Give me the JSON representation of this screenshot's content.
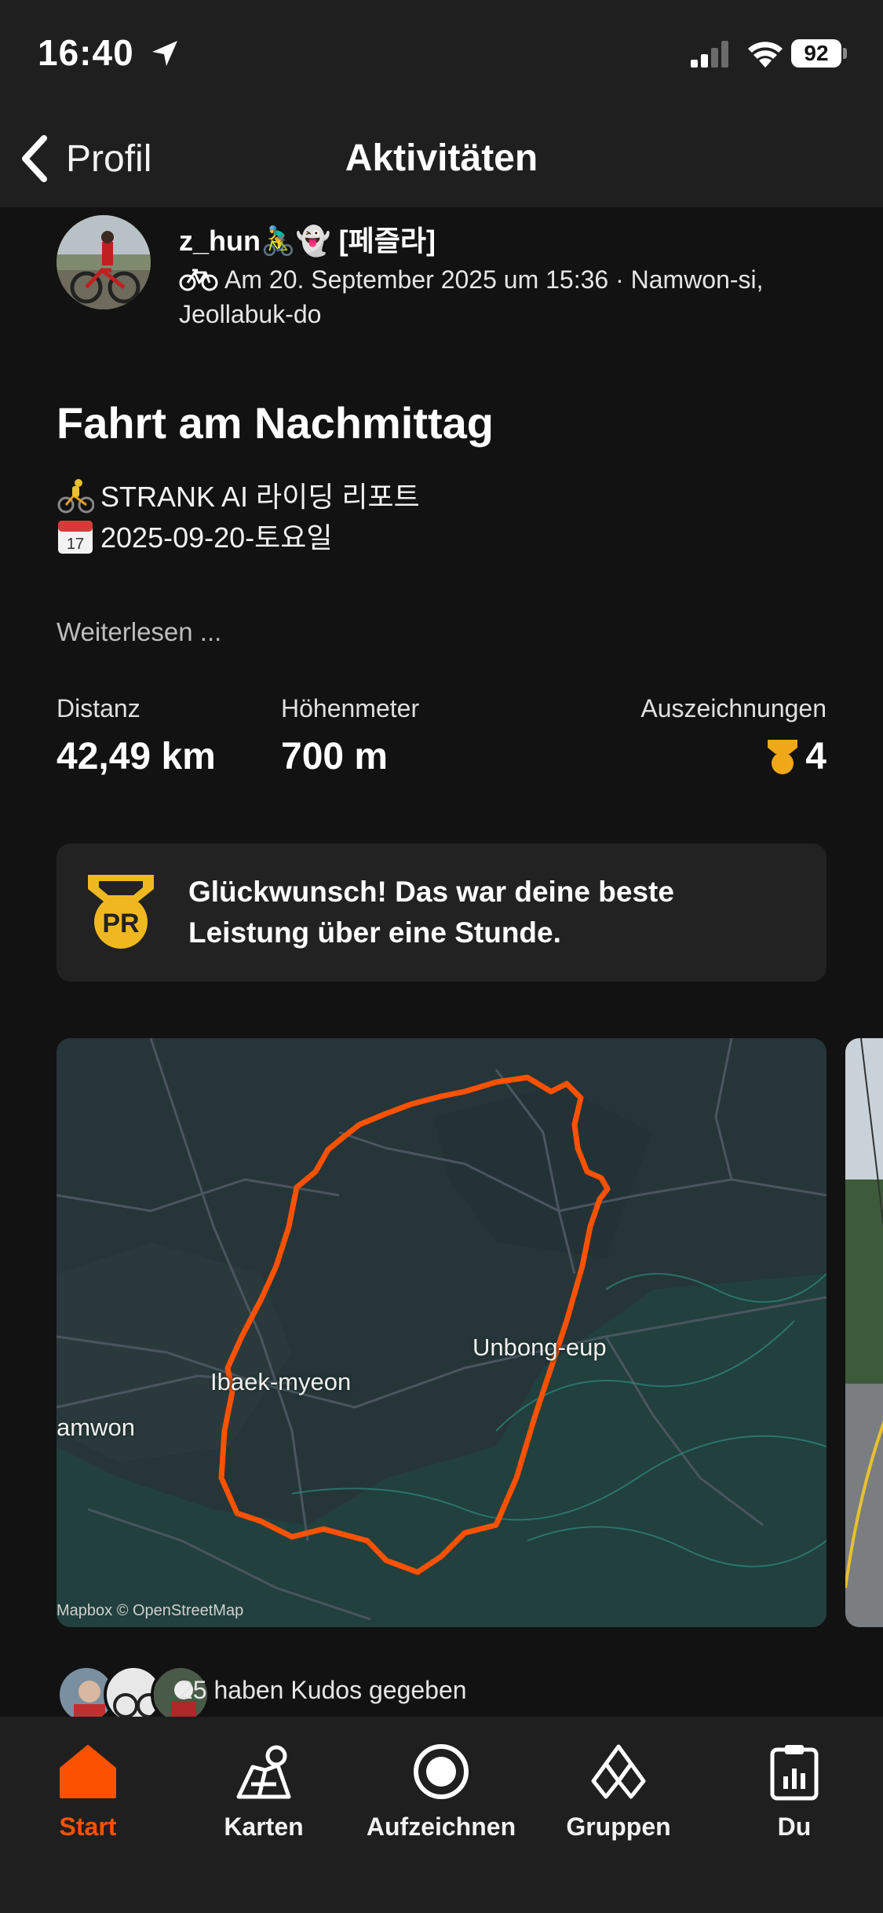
{
  "status_bar": {
    "time": "16:40",
    "battery": "92"
  },
  "nav": {
    "back_label": "Profil",
    "title": "Aktivitäten"
  },
  "post": {
    "user_name": "z_hun🚴‍♂️👻 [페즐라]",
    "meta_line": "Am 20. September 2025 um 15:36 · Namwon-si, Jeollabuk-do",
    "title": "Fahrt am Nachmittag",
    "description": [
      "STRANK AI 라이딩 리포트",
      "2025-09-20-토요일"
    ],
    "read_more": "Weiterlesen ..."
  },
  "stats": [
    {
      "label": "Distanz",
      "value": "42,49 km"
    },
    {
      "label": "Höhenmeter",
      "value": "700 m"
    },
    {
      "label": "Auszeichnungen",
      "value": "4"
    }
  ],
  "pr_banner": {
    "medal_text": "PR",
    "text": "Glückwunsch! Das war deine beste Leistung über eine Stunde."
  },
  "map": {
    "labels": [
      "Unbong-eup",
      "Ibaek-myeon",
      "amwon"
    ],
    "attribution": "Mapbox © OpenStreetMap",
    "route_color": "#fc5200"
  },
  "kudos": {
    "text": "25 haben Kudos gegeben"
  },
  "tabbar": {
    "accent": "#fc5200",
    "items": [
      {
        "label": "Start",
        "icon": "home-icon",
        "active": true
      },
      {
        "label": "Karten",
        "icon": "map-icon",
        "active": false
      },
      {
        "label": "Aufzeichnen",
        "icon": "record-icon",
        "active": false
      },
      {
        "label": "Gruppen",
        "icon": "groups-icon",
        "active": false
      },
      {
        "label": "Du",
        "icon": "clipboard-icon",
        "active": false
      }
    ]
  }
}
